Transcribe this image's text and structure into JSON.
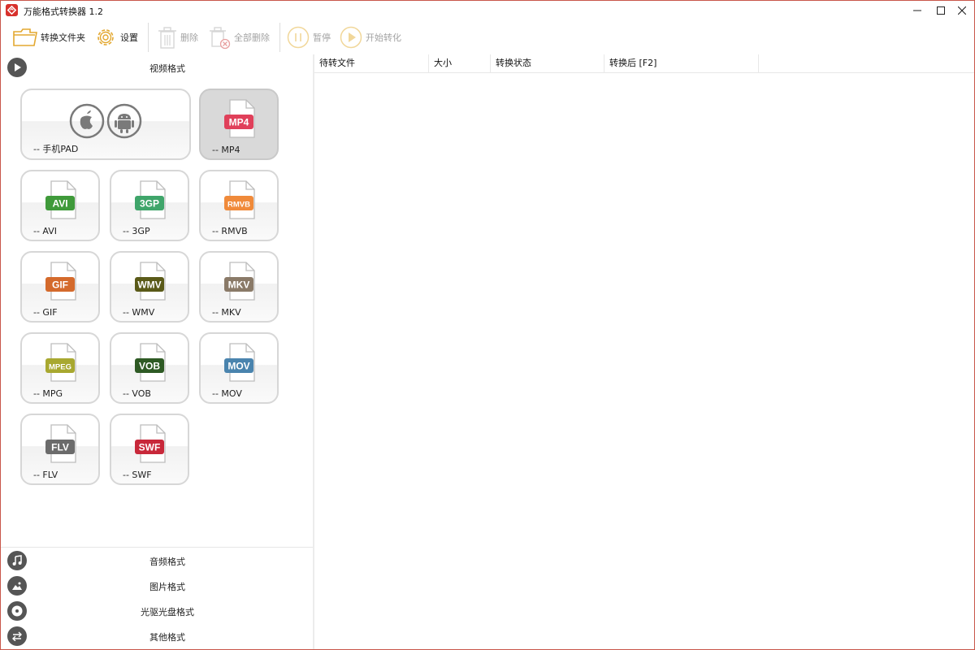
{
  "window": {
    "title": "万能格式转换器 1.2"
  },
  "toolbar": {
    "convert_folder": "转换文件夹",
    "settings": "设置",
    "delete": "删除",
    "delete_all": "全部删除",
    "pause": "暂停",
    "start": "开始转化"
  },
  "categories": {
    "video": "视频格式",
    "audio": "音频格式",
    "image": "图片格式",
    "disc": "光驱光盘格式",
    "other": "其他格式"
  },
  "tiles": [
    {
      "label": "-- 手机PAD",
      "badge": "",
      "color": ""
    },
    {
      "label": "-- MP4",
      "badge": "MP4",
      "color": "#e0405a"
    },
    {
      "label": "-- AVI",
      "badge": "AVI",
      "color": "#3f9a3a"
    },
    {
      "label": "-- 3GP",
      "badge": "3GP",
      "color": "#3fa56a"
    },
    {
      "label": "-- RMVB",
      "badge": "RMVB",
      "color": "#f08a3a"
    },
    {
      "label": "-- GIF",
      "badge": "GIF",
      "color": "#d46a2c"
    },
    {
      "label": "-- WMV",
      "badge": "WMV",
      "color": "#5a5a18"
    },
    {
      "label": "-- MKV",
      "badge": "MKV",
      "color": "#8a7a68"
    },
    {
      "label": "-- MPG",
      "badge": "MPEG",
      "color": "#a8a830"
    },
    {
      "label": "-- VOB",
      "badge": "VOB",
      "color": "#2e5a24"
    },
    {
      "label": "-- MOV",
      "badge": "MOV",
      "color": "#4a84ae"
    },
    {
      "label": "-- FLV",
      "badge": "FLV",
      "color": "#6b6b6b"
    },
    {
      "label": "-- SWF",
      "badge": "SWF",
      "color": "#c8283a"
    }
  ],
  "table": {
    "columns": [
      "待转文件",
      "大小",
      "转换状态",
      "转换后 [F2]"
    ]
  }
}
